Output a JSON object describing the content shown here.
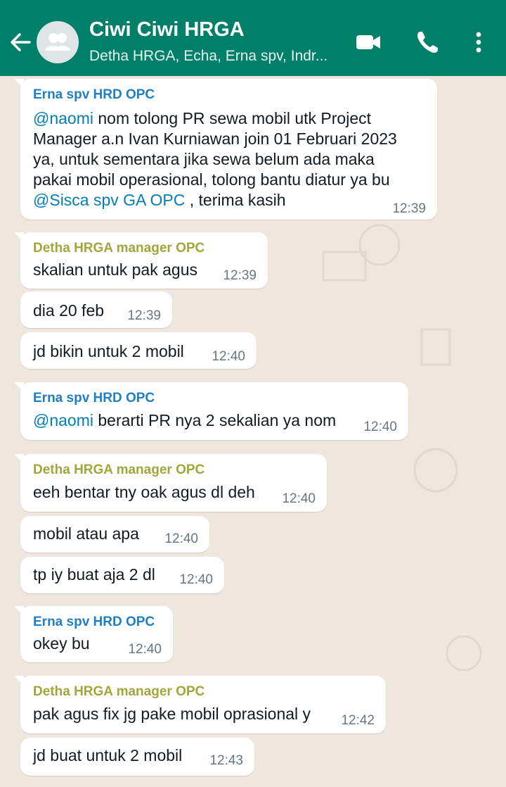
{
  "header": {
    "title": "Ciwi Ciwi HRGA",
    "subtitle": "Detha HRGA, Echa, Erna spv, Indr...",
    "icons": [
      "back-arrow-icon",
      "group-avatar-icon",
      "video-call-icon",
      "phone-icon",
      "more-vert-icon"
    ]
  },
  "colors": {
    "header": "#008069",
    "erna": "#1f7fc4",
    "detha": "#a0a73a",
    "mention": "#027eb5"
  },
  "messages": [
    {
      "sender": "Erna spv HRD OPC",
      "line1_mention": "@naomi",
      "line1_rest": " nom tolong PR sewa mobil utk Project",
      "line2": "Manager a.n Ivan Kurniawan join 01 Februari 2023",
      "line3": "ya, untuk sementara jika sewa belum ada maka",
      "line4": "pakai mobil operasional, tolong bantu diatur ya bu",
      "line5_mention": "@Sisca spv GA OPC",
      "line5_rest": " , terima kasih",
      "time": "12:39"
    },
    {
      "sender": "Detha HRGA manager OPC",
      "text": "skalian untuk pak agus",
      "time": "12:39"
    },
    {
      "text": "dia 20 feb",
      "time": "12:39"
    },
    {
      "text": "jd bikin untuk 2 mobil",
      "time": "12:40"
    },
    {
      "sender": "Erna spv HRD OPC",
      "mention": "@naomi",
      "text": " berarti PR nya 2 sekalian ya nom",
      "time": "12:40"
    },
    {
      "sender": "Detha HRGA manager OPC",
      "text": "eeh bentar tny oak agus dl deh",
      "time": "12:40"
    },
    {
      "text": "mobil atau apa",
      "time": "12:40"
    },
    {
      "text": "tp iy buat aja 2 dl",
      "time": "12:40"
    },
    {
      "sender": "Erna spv HRD OPC",
      "text": "okey bu",
      "time": "12:40"
    },
    {
      "sender": "Detha HRGA manager OPC",
      "text": "pak agus fix jg pake mobil oprasional y",
      "time": "12:42"
    },
    {
      "text": "jd buat untuk 2 mobil",
      "time": "12:43"
    }
  ]
}
